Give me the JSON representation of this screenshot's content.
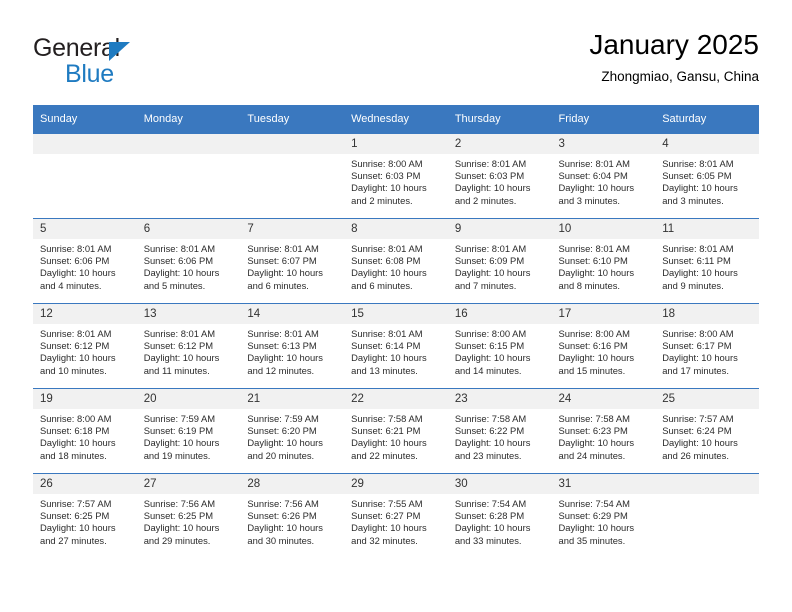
{
  "brand": {
    "name_top": "General",
    "name_bottom": "Blue",
    "accent_color": "#1f7bc1"
  },
  "header": {
    "title": "January 2025",
    "subtitle": "Zhongmiao, Gansu, China"
  },
  "theme": {
    "header_blue": "#3a78bf",
    "daynum_band": "#f1f1f1",
    "text": "#2b2b2b"
  },
  "weekdays": [
    "Sunday",
    "Monday",
    "Tuesday",
    "Wednesday",
    "Thursday",
    "Friday",
    "Saturday"
  ],
  "weeks": [
    [
      {
        "day": "",
        "empty": true
      },
      {
        "day": "",
        "empty": true
      },
      {
        "day": "",
        "empty": true
      },
      {
        "day": "1",
        "sunrise": "Sunrise: 8:00 AM",
        "sunset": "Sunset: 6:03 PM",
        "daylight": "Daylight: 10 hours and 2 minutes."
      },
      {
        "day": "2",
        "sunrise": "Sunrise: 8:01 AM",
        "sunset": "Sunset: 6:03 PM",
        "daylight": "Daylight: 10 hours and 2 minutes."
      },
      {
        "day": "3",
        "sunrise": "Sunrise: 8:01 AM",
        "sunset": "Sunset: 6:04 PM",
        "daylight": "Daylight: 10 hours and 3 minutes."
      },
      {
        "day": "4",
        "sunrise": "Sunrise: 8:01 AM",
        "sunset": "Sunset: 6:05 PM",
        "daylight": "Daylight: 10 hours and 3 minutes."
      }
    ],
    [
      {
        "day": "5",
        "sunrise": "Sunrise: 8:01 AM",
        "sunset": "Sunset: 6:06 PM",
        "daylight": "Daylight: 10 hours and 4 minutes."
      },
      {
        "day": "6",
        "sunrise": "Sunrise: 8:01 AM",
        "sunset": "Sunset: 6:06 PM",
        "daylight": "Daylight: 10 hours and 5 minutes."
      },
      {
        "day": "7",
        "sunrise": "Sunrise: 8:01 AM",
        "sunset": "Sunset: 6:07 PM",
        "daylight": "Daylight: 10 hours and 6 minutes."
      },
      {
        "day": "8",
        "sunrise": "Sunrise: 8:01 AM",
        "sunset": "Sunset: 6:08 PM",
        "daylight": "Daylight: 10 hours and 6 minutes."
      },
      {
        "day": "9",
        "sunrise": "Sunrise: 8:01 AM",
        "sunset": "Sunset: 6:09 PM",
        "daylight": "Daylight: 10 hours and 7 minutes."
      },
      {
        "day": "10",
        "sunrise": "Sunrise: 8:01 AM",
        "sunset": "Sunset: 6:10 PM",
        "daylight": "Daylight: 10 hours and 8 minutes."
      },
      {
        "day": "11",
        "sunrise": "Sunrise: 8:01 AM",
        "sunset": "Sunset: 6:11 PM",
        "daylight": "Daylight: 10 hours and 9 minutes."
      }
    ],
    [
      {
        "day": "12",
        "sunrise": "Sunrise: 8:01 AM",
        "sunset": "Sunset: 6:12 PM",
        "daylight": "Daylight: 10 hours and 10 minutes."
      },
      {
        "day": "13",
        "sunrise": "Sunrise: 8:01 AM",
        "sunset": "Sunset: 6:12 PM",
        "daylight": "Daylight: 10 hours and 11 minutes."
      },
      {
        "day": "14",
        "sunrise": "Sunrise: 8:01 AM",
        "sunset": "Sunset: 6:13 PM",
        "daylight": "Daylight: 10 hours and 12 minutes."
      },
      {
        "day": "15",
        "sunrise": "Sunrise: 8:01 AM",
        "sunset": "Sunset: 6:14 PM",
        "daylight": "Daylight: 10 hours and 13 minutes."
      },
      {
        "day": "16",
        "sunrise": "Sunrise: 8:00 AM",
        "sunset": "Sunset: 6:15 PM",
        "daylight": "Daylight: 10 hours and 14 minutes."
      },
      {
        "day": "17",
        "sunrise": "Sunrise: 8:00 AM",
        "sunset": "Sunset: 6:16 PM",
        "daylight": "Daylight: 10 hours and 15 minutes."
      },
      {
        "day": "18",
        "sunrise": "Sunrise: 8:00 AM",
        "sunset": "Sunset: 6:17 PM",
        "daylight": "Daylight: 10 hours and 17 minutes."
      }
    ],
    [
      {
        "day": "19",
        "sunrise": "Sunrise: 8:00 AM",
        "sunset": "Sunset: 6:18 PM",
        "daylight": "Daylight: 10 hours and 18 minutes."
      },
      {
        "day": "20",
        "sunrise": "Sunrise: 7:59 AM",
        "sunset": "Sunset: 6:19 PM",
        "daylight": "Daylight: 10 hours and 19 minutes."
      },
      {
        "day": "21",
        "sunrise": "Sunrise: 7:59 AM",
        "sunset": "Sunset: 6:20 PM",
        "daylight": "Daylight: 10 hours and 20 minutes."
      },
      {
        "day": "22",
        "sunrise": "Sunrise: 7:58 AM",
        "sunset": "Sunset: 6:21 PM",
        "daylight": "Daylight: 10 hours and 22 minutes."
      },
      {
        "day": "23",
        "sunrise": "Sunrise: 7:58 AM",
        "sunset": "Sunset: 6:22 PM",
        "daylight": "Daylight: 10 hours and 23 minutes."
      },
      {
        "day": "24",
        "sunrise": "Sunrise: 7:58 AM",
        "sunset": "Sunset: 6:23 PM",
        "daylight": "Daylight: 10 hours and 24 minutes."
      },
      {
        "day": "25",
        "sunrise": "Sunrise: 7:57 AM",
        "sunset": "Sunset: 6:24 PM",
        "daylight": "Daylight: 10 hours and 26 minutes."
      }
    ],
    [
      {
        "day": "26",
        "sunrise": "Sunrise: 7:57 AM",
        "sunset": "Sunset: 6:25 PM",
        "daylight": "Daylight: 10 hours and 27 minutes."
      },
      {
        "day": "27",
        "sunrise": "Sunrise: 7:56 AM",
        "sunset": "Sunset: 6:25 PM",
        "daylight": "Daylight: 10 hours and 29 minutes."
      },
      {
        "day": "28",
        "sunrise": "Sunrise: 7:56 AM",
        "sunset": "Sunset: 6:26 PM",
        "daylight": "Daylight: 10 hours and 30 minutes."
      },
      {
        "day": "29",
        "sunrise": "Sunrise: 7:55 AM",
        "sunset": "Sunset: 6:27 PM",
        "daylight": "Daylight: 10 hours and 32 minutes."
      },
      {
        "day": "30",
        "sunrise": "Sunrise: 7:54 AM",
        "sunset": "Sunset: 6:28 PM",
        "daylight": "Daylight: 10 hours and 33 minutes."
      },
      {
        "day": "31",
        "sunrise": "Sunrise: 7:54 AM",
        "sunset": "Sunset: 6:29 PM",
        "daylight": "Daylight: 10 hours and 35 minutes."
      },
      {
        "day": "",
        "empty": true
      }
    ]
  ]
}
